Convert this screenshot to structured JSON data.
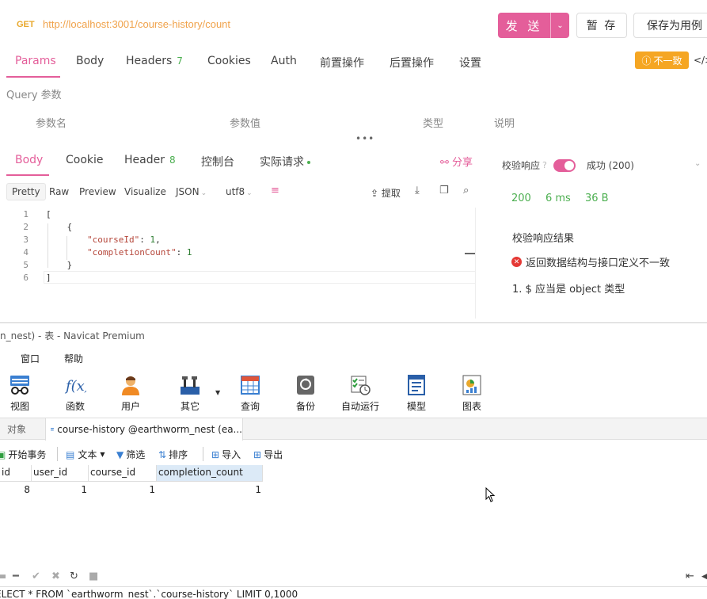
{
  "request": {
    "method": "GET",
    "url": "http://localhost:3001/course-history/count",
    "send_label": "发 送",
    "save_label": "暂 存",
    "save_as_label": "保存为用例"
  },
  "req_tabs": [
    {
      "label": "Params"
    },
    {
      "label": "Body"
    },
    {
      "label": "Headers",
      "count": "7"
    },
    {
      "label": "Cookies"
    },
    {
      "label": "Auth"
    },
    {
      "label": "前置操作"
    },
    {
      "label": "后置操作"
    },
    {
      "label": "设置"
    }
  ],
  "mismatch_badge": "不一致",
  "query": {
    "label": "Query 参数",
    "columns": [
      "参数名",
      "参数值",
      "类型",
      "说明"
    ]
  },
  "resp_tabs": [
    {
      "label": "Body"
    },
    {
      "label": "Cookie"
    },
    {
      "label": "Header",
      "count": "8"
    },
    {
      "label": "控制台"
    },
    {
      "label": "实际请求"
    }
  ],
  "share_label": "分享",
  "format_bar": {
    "pretty": "Pretty",
    "raw": "Raw",
    "preview": "Preview",
    "visualize": "Visualize",
    "format": "JSON",
    "encoding": "utf8",
    "extract": "提取"
  },
  "code_lines": [
    {
      "n": "1",
      "text": "["
    },
    {
      "n": "2",
      "text": "    {"
    },
    {
      "n": "3",
      "key": "\"courseId\"",
      "val": "1",
      "suffix": ","
    },
    {
      "n": "4",
      "key": "\"completionCount\"",
      "val": "1",
      "suffix": ""
    },
    {
      "n": "5",
      "text": "    }"
    },
    {
      "n": "6",
      "text": "]"
    }
  ],
  "validation": {
    "label": "校验响应",
    "status": "成功 (200)",
    "code": "200",
    "time": "6 ms",
    "size": "36 B",
    "result_title": "校验响应结果",
    "error": "返回数据结构与接口定义不一致",
    "detail": "1. $ 应当是 object 类型"
  },
  "navicat": {
    "title": "n_nest) - 表 - Navicat Premium",
    "menu": [
      "窗口",
      "帮助"
    ],
    "toolbar": [
      "视图",
      "函数",
      "用户",
      "其它",
      "查询",
      "备份",
      "自动运行",
      "模型",
      "图表"
    ],
    "tab_objects": "对象",
    "tab_table": "course-history @earthworm_nest (ea...",
    "actions": [
      "开始事务",
      "文本",
      "筛选",
      "排序",
      "导入",
      "导出"
    ],
    "columns": [
      "id",
      "user_id",
      "course_id",
      "completion_count"
    ],
    "rows": [
      [
        "8",
        "1",
        "1",
        "1"
      ]
    ],
    "sql": "ELECT * FROM `earthworm_nest`.`course-history` LIMIT 0,1000"
  },
  "colors": {
    "accent": "#e45e9a",
    "success": "#4caf50",
    "warning": "#f5a623",
    "error": "#e53935"
  }
}
